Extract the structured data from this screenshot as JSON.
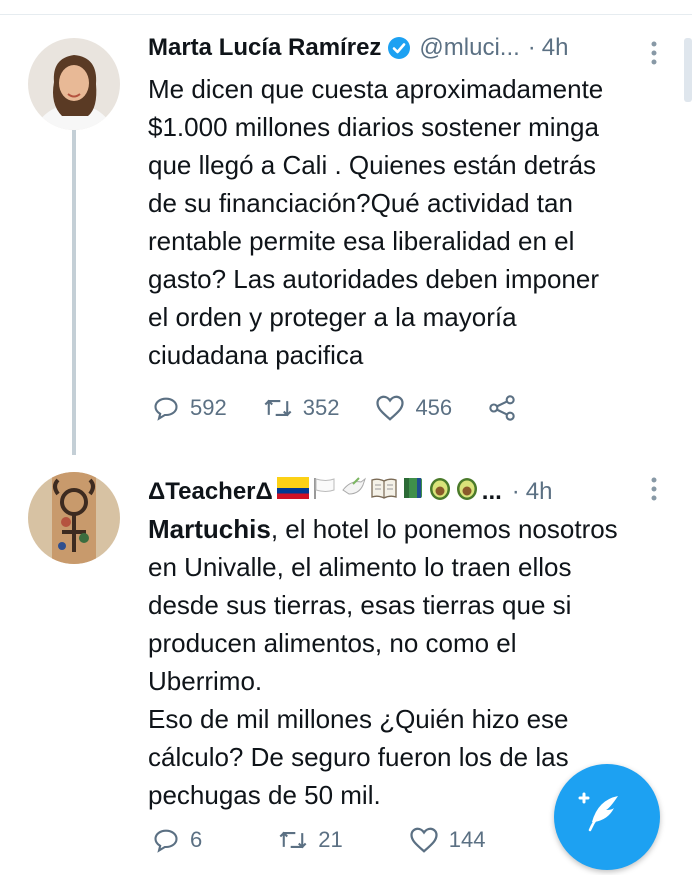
{
  "tweets": [
    {
      "display_name": "Marta Lucía Ramírez",
      "handle": "@mluci...",
      "separator": "·",
      "time": "4h",
      "text": "Me dicen que cuesta aproximadamente\n$1.000 millones diarios sostener minga\nque llegó a Cali . Quienes están detrás\nde su financiación?Qué actividad tan\nrentable permite esa liberalidad en el\ngasto? Las autoridades deben imponer\nel orden y proteger a la mayoría\nciudadana pacifica",
      "replies": "592",
      "retweets": "352",
      "likes": "456",
      "verified": true
    },
    {
      "display_name": "ΔTeacherΔ",
      "display_name_suffix": "...",
      "separator": "·",
      "time": "4h",
      "text_bold": "Martuchis",
      "text": ", el hotel lo ponemos nosotros\nen Univalle, el alimento lo traen ellos\ndesde sus tierras, esas tierras que si\nproducen alimentos, no como el\nUberrimo.\nEso de mil millones ¿Quién hizo ese\ncálculo? De seguro fueron los de las\npechugas de 50 mil.",
      "replies": "6",
      "retweets": "21",
      "likes": "144",
      "name_emojis": [
        "colombia-flag",
        "white-flag",
        "dove",
        "open-book",
        "green-book",
        "avocado",
        "avocado"
      ]
    }
  ],
  "colors": {
    "accent": "#1da1f2",
    "muted": "#5b7083",
    "thread_line": "#c4cfd6"
  }
}
